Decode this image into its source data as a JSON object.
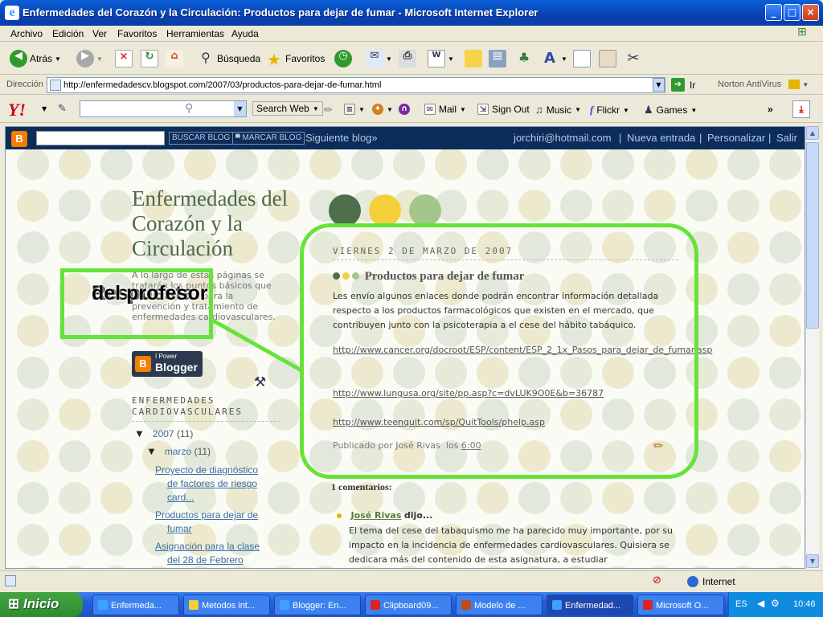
{
  "window": {
    "title": "Enfermedades del Corazón y la Circulación: Productos para dejar de fumar - Microsoft Internet Explorer"
  },
  "menu": [
    "Archivo",
    "Edición",
    "Ver",
    "Favoritos",
    "Herramientas",
    "Ayuda"
  ],
  "toolbar": {
    "back": "Atrás",
    "search": "Búsqueda",
    "favorites": "Favoritos"
  },
  "address": {
    "label": "Dirección",
    "url": "http://enfermedadescv.blogspot.com/2007/03/productos-para-dejar-de-fumar.html",
    "go": "Ir",
    "norton": "Norton AntiVirus"
  },
  "yahoo": {
    "logo": "Y!",
    "search_web": "Search Web",
    "mail": "Mail",
    "signout": "Sign Out",
    "music": "Music",
    "flickr": "Flickr",
    "games": "Games"
  },
  "bloggerbar": {
    "search_btn": "BUSCAR BLOG",
    "flag_btn": "MARCAR BLOG",
    "next": "Siguiente blog»",
    "user": "jorchiri@hotmail.com",
    "new_post": "Nueva entrada",
    "customize": "Personalizar",
    "logout": "Salir",
    "sep": "|"
  },
  "blog": {
    "title": "Enfermedades del Corazón y la Circulación",
    "description": "A lo largo de estas páginas se tratarán los puntos básicos que deben seguirse para la prevención y tratamiento de enfermedades cardiovasculares.",
    "badge_small": "I Power",
    "badge_large": "Blogger",
    "badge_logo": "B",
    "sidebar_header": "ENFERMEDADES CARDIOVASCULARES",
    "archive_year": "2007",
    "archive_year_count": "(11)",
    "archive_month": "marzo",
    "archive_month_count": "(11)",
    "archive_posts": [
      {
        "line1": "Proyecto de diagnóstico",
        "line2": "de factores de riesgo",
        "line3": "card..."
      },
      {
        "line1": "Productos para dejar de",
        "line2": "fumar",
        "line3": ""
      },
      {
        "line1": "Asignación para la clase",
        "line2": "del 28 de Febrero",
        "line3": ""
      }
    ],
    "colors": {
      "dark_green": "#4f6e4c",
      "yellow": "#f3cf3a",
      "light_green": "#a3c68a",
      "callout": "#66e33a"
    }
  },
  "post": {
    "date": "VIERNES 2 DE MARZO DE 2007",
    "title": "Productos para dejar de fumar",
    "body": "Les envío algunos enlaces donde podrán encontrar información detallada respecto a los productos farmacológicos que existen en el mercado, que contribuyen junto con la psicoterapia a el cese del hábito tabáquico.",
    "links": [
      "http://www.cancer.org/docroot/ESP/content/ESP_2_1x_Pasos_para_dejar_de_fumar.asp",
      "http://www.lungusa.org/site/pp.asp?c=dvLUK9O0E&b=36787",
      "http://www.teenquit.com/sp/QuitTools/phelp.asp"
    ],
    "published_prefix": "Publicado por José Rivas",
    "published_at": "los",
    "time": "6:00"
  },
  "comments": {
    "count_title": "1 comentarios:",
    "author": "José Rivas",
    "said": "dijo...",
    "body": "El tema del cese del tabaquismo me ha parecido muy importante, por su impacto en la incidencia de enfermedades cardiovasculares. Quisiera se dedicara más del contenido de esta asignatura, a estudiar"
  },
  "annotation": {
    "line1": "Respuesta",
    "line2": "del profesor"
  },
  "statusbar": {
    "zone": "Internet"
  },
  "taskbar": {
    "start": "Inicio",
    "tasks": [
      "Enfermeda...",
      "Metodos int...",
      "Blogger: En...",
      "Clipboard09...",
      "Modelo de ...",
      "Enfermedad...",
      "Microsoft O..."
    ],
    "lang": "ES",
    "clock": "10:46"
  }
}
